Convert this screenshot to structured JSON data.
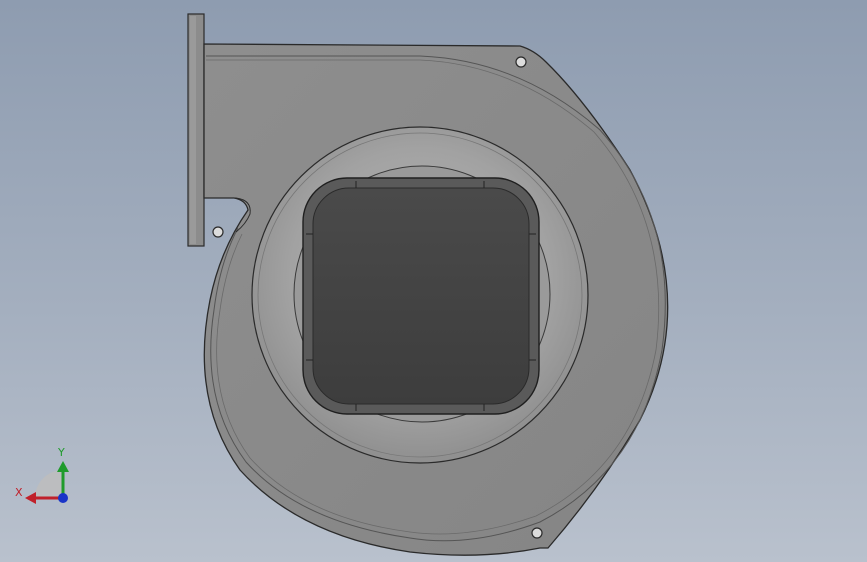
{
  "app": {
    "view": "front"
  },
  "colors": {
    "background_top": "#8e9cb0",
    "background_bottom": "#b9c1cd",
    "housing_body": "#8a8a8a",
    "housing_edge": "#2a2a2a",
    "inlet_dark": "#444444",
    "inlet_ring": "#a8a8a8",
    "axis_x": "#c0202a",
    "axis_y": "#1f9b2c",
    "axis_z": "#1a35c8"
  },
  "triad": {
    "x_label": "X",
    "y_label": "Y"
  },
  "icons": {
    "triad": "orientation-triad-icon",
    "mount_hole": "mounting-hole-icon"
  }
}
